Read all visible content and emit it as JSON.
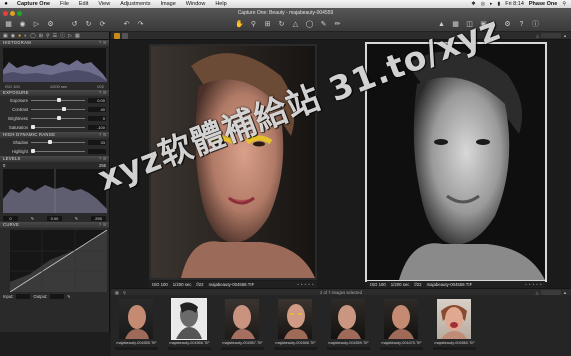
{
  "menubar": {
    "apple": "",
    "items": [
      "Capture One",
      "File",
      "Edit",
      "View",
      "Adjustments",
      "Image",
      "Window",
      "Help"
    ],
    "clock": "Fri 8:14",
    "user": "Phase One"
  },
  "window": {
    "title": "Capture One: Beauty - majabeauty-004559"
  },
  "left": {
    "histogram": {
      "title": "HISTOGRAM",
      "iso": "ISO 100",
      "shutter": "1/200 sec",
      "aperture": "f/22"
    },
    "exposure": {
      "title": "EXPOSURE",
      "sliders": [
        {
          "label": "Exposure",
          "value": "0.00",
          "pos": 0.5
        },
        {
          "label": "Contrast",
          "value": "40",
          "pos": 0.6
        },
        {
          "label": "Brightness",
          "value": "0",
          "pos": 0.5
        },
        {
          "label": "Saturation",
          "value": "-100",
          "pos": 0.0
        }
      ]
    },
    "hdr": {
      "title": "HIGH DYNAMIC RANGE",
      "sliders": [
        {
          "label": "Shadow",
          "value": "33",
          "pos": 0.33
        },
        {
          "label": "Highlight",
          "value": "",
          "pos": 0.0
        }
      ]
    },
    "levels": {
      "title": "LEVELS",
      "top_left": "0",
      "top_right": "255",
      "low": "0",
      "mid": "0.00",
      "high": "255"
    },
    "curve": {
      "title": "CURVE",
      "input_label": "Input:",
      "output_label": "Output:"
    }
  },
  "viewer": {
    "left_photo": {
      "iso": "ISO 100",
      "shutter": "1/200 sec",
      "aperture": "f/22",
      "name": "majabeauty-004558.TIF"
    },
    "right_photo": {
      "iso": "ISO 100",
      "shutter": "1/200 sec",
      "aperture": "f/22",
      "name": "majabeauty-004559.TIF"
    }
  },
  "filmbar": {
    "status": "2 of 7 images selected"
  },
  "filmstrip": {
    "thumbs": [
      {
        "name": "majabeauty-004555.TIF"
      },
      {
        "name": "majabeauty-004556.TIF"
      },
      {
        "name": "majabeauty-004557.TIF"
      },
      {
        "name": "majabeauty-004558.TIF"
      },
      {
        "name": "majabeauty-004559.TIF"
      },
      {
        "name": "majabeauty-004475.TIF"
      },
      {
        "name": "majabeauty-004560.TIF"
      }
    ]
  },
  "watermark": "xyz软體補給站 31.to/xyz",
  "colors": {
    "accent": "#f0a020",
    "selected_border": "#d8d8d8"
  }
}
